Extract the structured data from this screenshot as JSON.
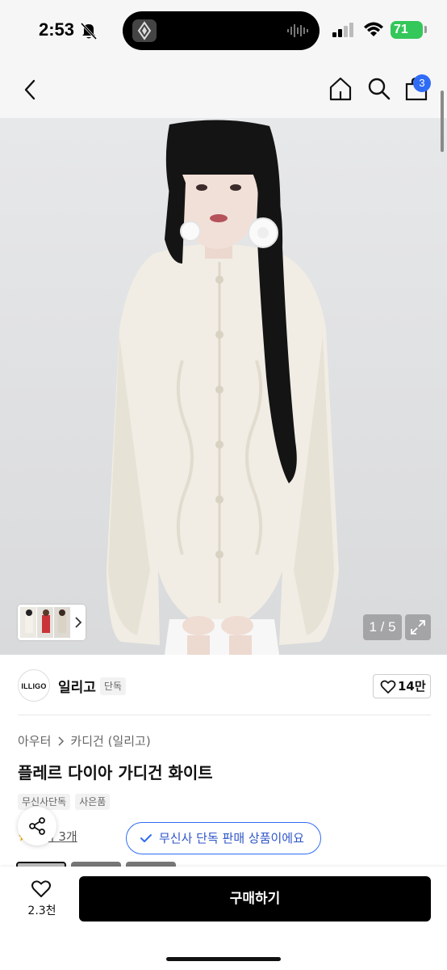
{
  "status_bar": {
    "time": "2:53",
    "battery": "71"
  },
  "nav": {
    "cart_count": "3"
  },
  "hero": {
    "page_indicator": "1 / 5"
  },
  "brand": {
    "logo_text": "ILLIGO",
    "name": "일리고",
    "tag": "단독",
    "like_count": "14만"
  },
  "product": {
    "breadcrumb": [
      "아우터",
      "카디건 (일리고)"
    ],
    "title": "플레르 다이아 가디건 화이트",
    "tags": [
      "무신사단독",
      "사은품"
    ],
    "review_text": "후기 3개",
    "exclusive_label": "무신사 단독 판매 상품이에요"
  },
  "bottom": {
    "like_count": "2.3천",
    "buy_label": "구매하기"
  },
  "colors": {
    "accent": "#2f6cf6",
    "battery": "#34c759",
    "buy": "#000000"
  }
}
